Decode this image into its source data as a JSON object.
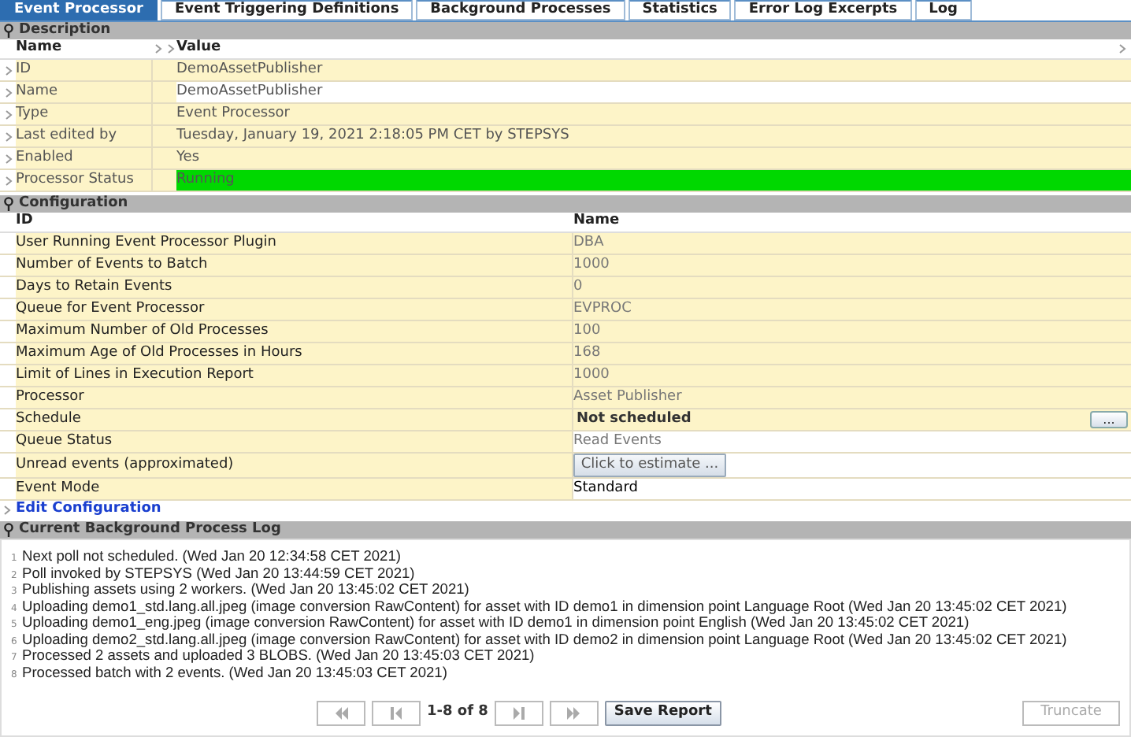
{
  "tabs": [
    {
      "label": "Event Processor",
      "selected": true
    },
    {
      "label": "Event Triggering Definitions",
      "selected": false
    },
    {
      "label": "Background Processes",
      "selected": false
    },
    {
      "label": "Statistics",
      "selected": false
    },
    {
      "label": "Error Log Excerpts",
      "selected": false
    },
    {
      "label": "Log",
      "selected": false
    }
  ],
  "description": {
    "title": "Description",
    "columns": [
      "Name",
      "Value"
    ],
    "rows": [
      {
        "name": "ID",
        "value": "DemoAssetPublisher",
        "highlighted": true
      },
      {
        "name": "Name",
        "value": "DemoAssetPublisher",
        "highlighted": false
      },
      {
        "name": "Type",
        "value": "Event Processor",
        "highlighted": true
      },
      {
        "name": "Last edited by",
        "value": "Tuesday, January 19, 2021 2:18:05 PM CET by STEPSYS",
        "highlighted": true
      },
      {
        "name": "Enabled",
        "value": "Yes",
        "highlighted": true
      },
      {
        "name": "Processor Status",
        "value": "Running",
        "color": "#00d800"
      }
    ]
  },
  "configuration": {
    "title": "Configuration",
    "columns": [
      "ID",
      "Name"
    ],
    "rows": [
      {
        "id": "User Running Event Processor Plugin",
        "value": "DBA",
        "kind": "text",
        "highlighted": true
      },
      {
        "id": "Number of Events to Batch",
        "value": "1000",
        "kind": "text",
        "highlighted": true
      },
      {
        "id": "Days to Retain Events",
        "value": "0",
        "kind": "text",
        "highlighted": true
      },
      {
        "id": "Queue for Event Processor",
        "value": "EVPROC",
        "kind": "text",
        "highlighted": true
      },
      {
        "id": "Maximum Number of Old Processes",
        "value": "100",
        "kind": "text",
        "highlighted": true
      },
      {
        "id": "Maximum Age of Old Processes in Hours",
        "value": "168",
        "kind": "text",
        "highlighted": true
      },
      {
        "id": "Limit of Lines in Execution Report",
        "value": "1000",
        "kind": "text",
        "highlighted": true
      },
      {
        "id": "Processor",
        "value": "Asset Publisher",
        "kind": "text",
        "highlighted": true
      },
      {
        "id": "Schedule",
        "value": "Not scheduled",
        "kind": "bold",
        "button": "...",
        "highlighted": true
      },
      {
        "id": "Queue Status",
        "value": "Read Events",
        "kind": "text",
        "highlighted": false
      },
      {
        "id": "Unread events (approximated)",
        "value": "Click to estimate ...",
        "kind": "button",
        "highlighted": false
      },
      {
        "id": "Event Mode",
        "value": "Standard",
        "kind": "plain",
        "highlighted": false
      }
    ],
    "edit_link": "Edit Configuration"
  },
  "log": {
    "title": "Current Background Process Log",
    "lines": [
      {
        "number": "1",
        "text": "Next poll not scheduled. (Wed Jan 20 12:34:58 CET 2021)"
      },
      {
        "number": "2",
        "text": "Poll invoked by STEPSYS (Wed Jan 20 13:44:59 CET 2021)"
      },
      {
        "number": "3",
        "text": "Publishing assets using 2 workers. (Wed Jan 20 13:45:02 CET 2021)"
      },
      {
        "number": "4",
        "text": "Uploading demo1_std.lang.all.jpeg (image conversion RawContent) for asset with ID demo1 in dimension point Language Root (Wed Jan 20 13:45:02 CET 2021)"
      },
      {
        "number": "5",
        "text": "Uploading demo1_eng.jpeg (image conversion RawContent) for asset with ID demo1 in dimension point English (Wed Jan 20 13:45:02 CET 2021)"
      },
      {
        "number": "6",
        "text": "Uploading demo2_std.lang.all.jpeg (image conversion RawContent) for asset with ID demo2 in dimension point Language Root (Wed Jan 20 13:45:02 CET 2021)"
      },
      {
        "number": "7",
        "text": "Processed 2 assets and uploaded 3 BLOBS. (Wed Jan 20 13:45:03 CET 2021)"
      },
      {
        "number": "8",
        "text": "Processed batch with 2 events. (Wed Jan 20 13:45:03 CET 2021)"
      }
    ],
    "page": "1-8 of 8",
    "save_button": "Save Report",
    "truncate_button": {
      "label": "Truncate",
      "disabled": true
    }
  }
}
